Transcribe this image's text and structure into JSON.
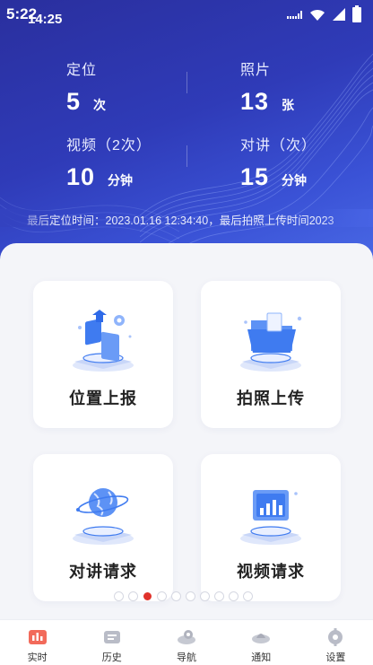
{
  "status_bar": {
    "time_primary": "5:22",
    "time_secondary": "14:25"
  },
  "stats": [
    {
      "label": "定位",
      "value": "5",
      "unit": "次"
    },
    {
      "label": "照片",
      "value": "13",
      "unit": "张"
    },
    {
      "label": "视频（2次）",
      "value": "10",
      "unit": "分钟"
    },
    {
      "label": "对讲（次）",
      "value": "15",
      "unit": "分钟"
    }
  ],
  "ticker": {
    "text": "最后定位时间：2023.01.16 12:34:40，最后拍照上传时间2023"
  },
  "cards": [
    {
      "title": "位置上报",
      "icon": "location-report-icon"
    },
    {
      "title": "拍照上传",
      "icon": "photo-upload-icon"
    },
    {
      "title": "对讲请求",
      "icon": "intercom-globe-icon"
    },
    {
      "title": "视频请求",
      "icon": "video-chart-icon"
    }
  ],
  "pagination": {
    "total": 10,
    "active_index": 2
  },
  "tabs": [
    {
      "label": "实时",
      "icon": "realtime-icon",
      "active": true
    },
    {
      "label": "历史",
      "icon": "history-icon",
      "active": false
    },
    {
      "label": "导航",
      "icon": "navigation-icon",
      "active": false
    },
    {
      "label": "通知",
      "icon": "notification-icon",
      "active": false
    },
    {
      "label": "设置",
      "icon": "settings-icon",
      "active": false
    }
  ],
  "colors": {
    "header_start": "#2a2f9e",
    "header_end": "#4a6ae6",
    "accent_red": "#e0322b",
    "illustration_blue": "#3f7bf0"
  }
}
